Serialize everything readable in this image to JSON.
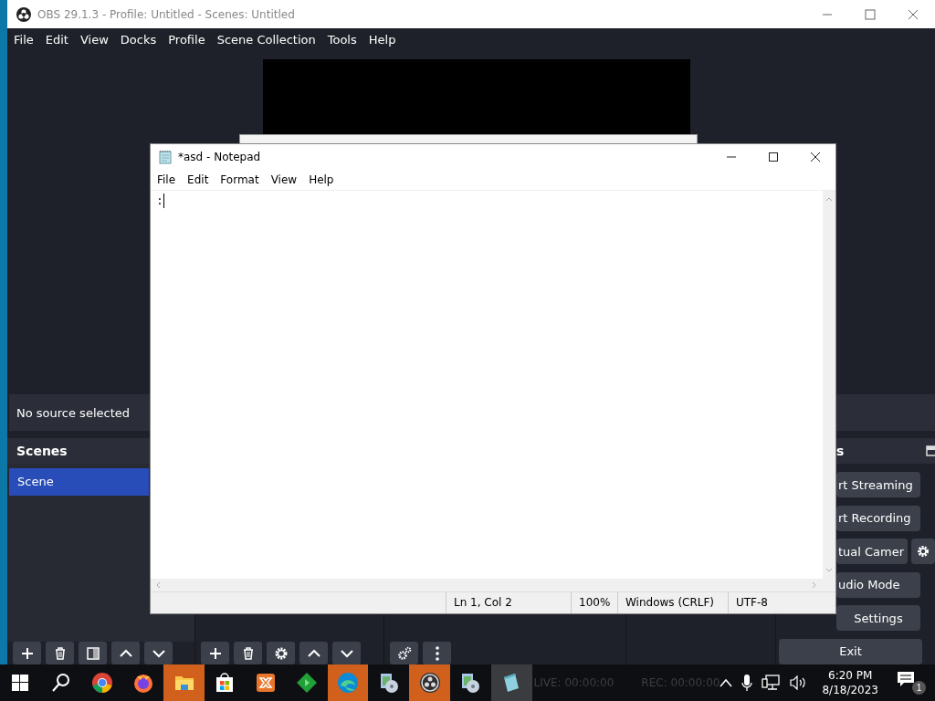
{
  "obs": {
    "title": "OBS 29.1.3 - Profile: Untitled - Scenes: Untitled",
    "menu": [
      "File",
      "Edit",
      "View",
      "Docks",
      "Profile",
      "Scene Collection",
      "Tools",
      "Help"
    ],
    "source_label": "No source selected",
    "scenes": {
      "title": "Scenes",
      "items": [
        {
          "label": "Scene",
          "selected": true
        }
      ],
      "toolbar": [
        {
          "kind": "add"
        },
        {
          "kind": "remove"
        },
        {
          "kind": "filter"
        },
        {
          "kind": "up"
        },
        {
          "kind": "down"
        }
      ]
    },
    "sources": {
      "toolbar": [
        {
          "kind": "add"
        },
        {
          "kind": "remove"
        },
        {
          "kind": "gear"
        },
        {
          "kind": "up"
        },
        {
          "kind": "down"
        }
      ]
    },
    "mixer": {
      "toolbar": [
        {
          "kind": "gears"
        },
        {
          "kind": "dots"
        }
      ]
    },
    "controls": {
      "title": "s",
      "buttons": [
        {
          "label": "rt Streaming",
          "kind": "cut"
        },
        {
          "label": "rt Recording",
          "kind": "cut"
        },
        {
          "label": "tual Camer",
          "kind": "split"
        },
        {
          "label": "udio Mode",
          "kind": "cut"
        },
        {
          "label": "Settings",
          "kind": "full"
        },
        {
          "label": "Exit",
          "kind": "full"
        }
      ]
    },
    "status": [
      "LIVE: 00:00:00",
      "REC: 00:00:00"
    ]
  },
  "notepad": {
    "title": "*asd - Notepad",
    "menu": [
      "File",
      "Edit",
      "Format",
      "View",
      "Help"
    ],
    "text": ":",
    "status": [
      "Ln 1, Col 2",
      "100%",
      "Windows (CRLF)",
      "UTF-8"
    ]
  },
  "taskbar": {
    "apps": [
      {
        "kind": "start",
        "flashing": false,
        "selected": false
      },
      {
        "kind": "search",
        "flashing": false,
        "selected": false
      },
      {
        "kind": "globe",
        "flashing": false,
        "selected": false
      },
      {
        "kind": "fox",
        "flashing": false,
        "selected": false
      },
      {
        "kind": "folder",
        "flashing": true,
        "selected": false
      },
      {
        "kind": "bag",
        "flashing": false,
        "selected": false
      },
      {
        "kind": "tile",
        "flashing": false,
        "selected": false
      },
      {
        "kind": "diamond",
        "flashing": false,
        "selected": false
      },
      {
        "kind": "wave",
        "flashing": true,
        "selected": false
      },
      {
        "kind": "disc",
        "flashing": false,
        "selected": false
      },
      {
        "kind": "ring",
        "flashing": true,
        "selected": false
      },
      {
        "kind": "disc",
        "flashing": false,
        "selected": false
      },
      {
        "kind": "pad",
        "flashing": false,
        "selected": true
      }
    ],
    "time": "6:20 PM",
    "date": "8/18/2023",
    "notifications": "1"
  }
}
